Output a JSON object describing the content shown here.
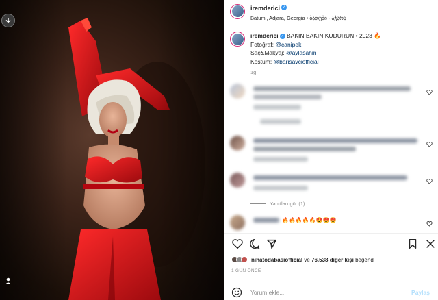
{
  "post": {
    "username": "iremderici",
    "location": "Batumi, Adjara, Georgia • ბათუმი - აჭარა",
    "caption_username": "iremderici",
    "caption_title": "BAKIN BAKIN KUDURUN • 2023 🔥",
    "credit_photo_label": "Fotoğraf: ",
    "credit_photo_handle": "@canipek",
    "credit_hair_label": "Saç&Makyaj: ",
    "credit_hair_handle": "@aylasahin",
    "credit_costume_label": "Kostüm: ",
    "credit_costume_handle": "@barisavciofficial",
    "caption_time": "1g"
  },
  "comments": {
    "replies_label": "Yanıtları gör (1)",
    "emoji_line": "🔥🔥🔥🔥🔥😍😍😍"
  },
  "likes": {
    "liker": "nihatodabasiofficial",
    "connector": " ve ",
    "count_text": "76.538 diğer kişi",
    "suffix": " beğendi"
  },
  "date_label": "1 GÜN ÖNCE",
  "comment_box": {
    "placeholder": "Yorum ekle...",
    "post_label": "Paylaş"
  },
  "icons": [
    "download-icon",
    "user-tag-icon",
    "heart-icon",
    "comment-icon",
    "share-icon",
    "bookmark-icon",
    "more-icon",
    "emoji-icon",
    "verified-icon"
  ],
  "colors": {
    "accent": "#3897f0",
    "link": "#00376b",
    "muted": "#8e8e8e",
    "post_disabled": "#b2dffc",
    "dress": "#d0141a"
  }
}
